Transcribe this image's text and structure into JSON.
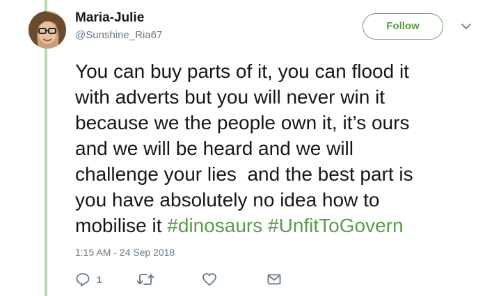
{
  "tweet": {
    "author": {
      "display_name": "Maria-Julie",
      "handle": "@Sunshine_Ria67",
      "avatar_icon": "profile-photo"
    },
    "follow_label": "Follow",
    "text_lines": [
      "You can buy parts of it, you can flood it",
      "with adverts but you will never win it",
      "because we the people own it, it’s ours",
      "and we will be heard and we will",
      "challenge your lies  and the best part is",
      "you have absolutely no idea how to",
      "mobilise it "
    ],
    "hashtags": [
      "#dinosaurs",
      "#UnfitToGovern"
    ],
    "timestamp": "1:15 AM - 24 Sep 2018",
    "actions": {
      "reply_count": "1",
      "icons": [
        "reply-icon",
        "retweet-icon",
        "like-icon",
        "direct-message-icon"
      ]
    }
  },
  "colors": {
    "accent_green": "#5a9a4d",
    "quote_bar": "#b6d9b0",
    "secondary_text": "#657786",
    "primary_text": "#14171a"
  }
}
